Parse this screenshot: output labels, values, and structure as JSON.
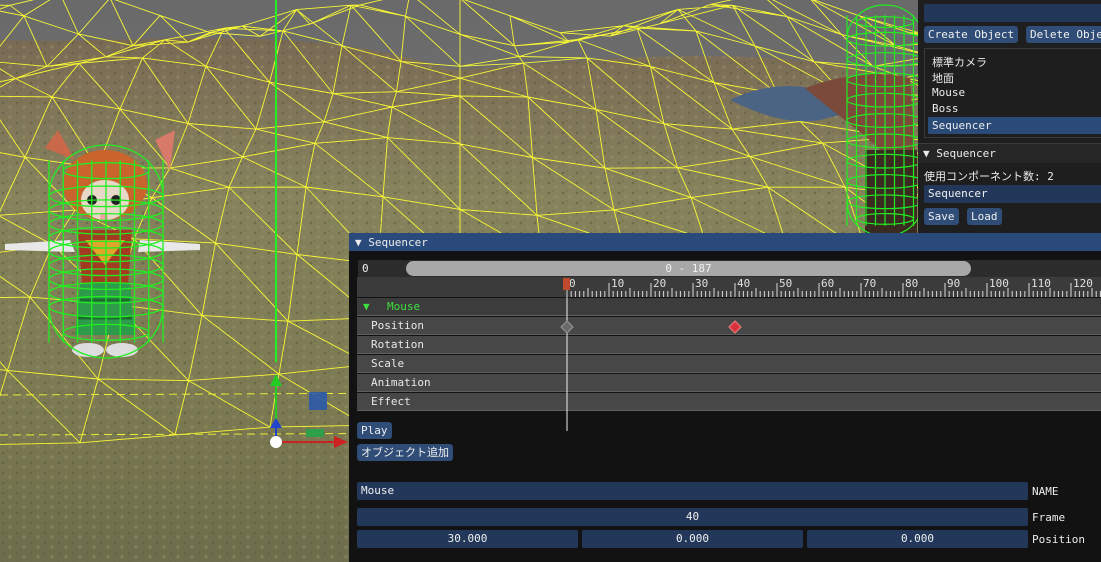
{
  "right_panel": {
    "top_input_value": "",
    "create_button": "Create Object",
    "delete_button": "Delete Obje",
    "object_list": [
      "標準カメラ",
      "地面",
      "Mouse",
      "Boss",
      "Sequencer"
    ],
    "selected_object": "Sequencer",
    "section_header": "▼ Sequencer",
    "component_count_label": "使用コンポーネント数: 2",
    "component_name": "Sequencer",
    "save_button": "Save",
    "load_button": "Load"
  },
  "sequencer": {
    "title": "▼ Sequencer",
    "current_frame_field": "0",
    "range_label": "0 - 187",
    "ruler_ticks": [
      "0",
      "10",
      "20",
      "30",
      "40",
      "50",
      "60",
      "70",
      "80",
      "90",
      "100",
      "110",
      "120"
    ],
    "group_arrow": "▼",
    "group_name": "Mouse",
    "tracks": [
      "Position",
      "Rotation",
      "Scale",
      "Animation",
      "Effect"
    ],
    "keyframe_frames": [
      0,
      40
    ],
    "play_button": "Play",
    "add_object_button": "オブジェクト追加"
  },
  "inspector": {
    "name_value": "Mouse",
    "name_label": "NAME",
    "frame_value": "40",
    "frame_label": "Frame",
    "position_values": [
      "30.000",
      "0.000",
      "0.000"
    ],
    "position_label": "Position"
  },
  "colors": {
    "wireframe": "#ffff33",
    "collider": "#22ee22",
    "window_title_bar": "#294a7a",
    "field_bg": "#223759",
    "button_bg": "#2f4d76",
    "keyframe_selected": "#d8333a",
    "group_text": "#3ee03e"
  }
}
